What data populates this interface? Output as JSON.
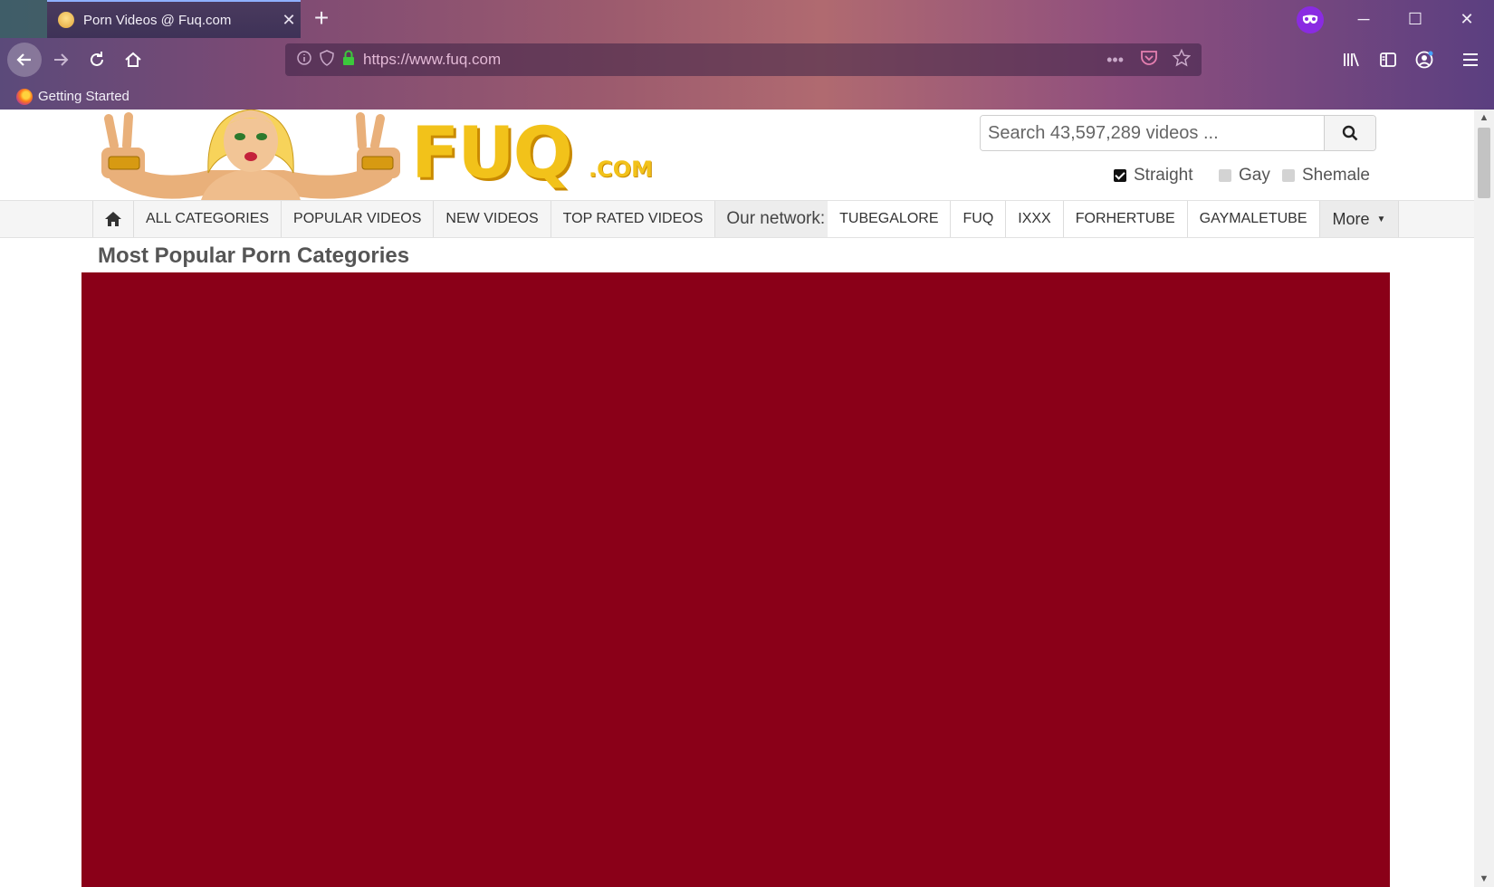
{
  "browser": {
    "tab": {
      "title": "Porn Videos @ Fuq.com"
    },
    "url": "https://www.fuq.com",
    "bookmarks": [
      {
        "label": "Getting Started"
      }
    ],
    "colors": {
      "private_badge": "#8a2be2"
    },
    "icons": [
      "back-icon",
      "forward-icon",
      "reload-icon",
      "home-icon",
      "info-icon",
      "shield-icon",
      "lock-icon",
      "more-dots-icon",
      "pocket-icon",
      "star-icon",
      "library-icon",
      "sidebar-icon",
      "account-icon",
      "hamburger-menu-icon"
    ]
  },
  "site": {
    "logo": {
      "main": "FUQ",
      "suffix": ".COM"
    },
    "search": {
      "placeholder": "Search 43,597,289 videos ..."
    },
    "orientation": [
      {
        "label": "Straight",
        "checked": true
      },
      {
        "label": "Gay",
        "checked": false
      },
      {
        "label": "Shemale",
        "checked": false
      }
    ],
    "menu": {
      "items": [
        "ALL CATEGORIES",
        "POPULAR VIDEOS",
        "NEW VIDEOS",
        "TOP RATED VIDEOS"
      ],
      "network_label": "Our network:",
      "network": [
        "TUBEGALORE",
        "FUQ",
        "IXXX",
        "FORHERTUBE",
        "GAYMALETUBE"
      ],
      "more": "More"
    },
    "section_title": "Most Popular Porn Categories",
    "colors": {
      "ad_block": "#8a0018",
      "logo_yellow": "#f2c21a"
    }
  }
}
